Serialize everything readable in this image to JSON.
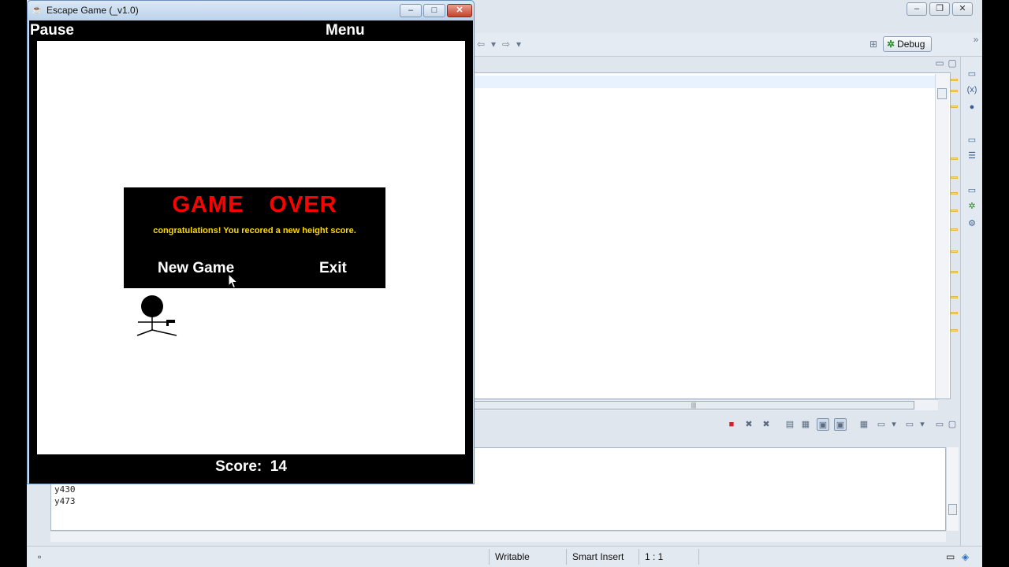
{
  "ide": {
    "perspective_label": "Debug",
    "console_lines": [
      "y430",
      "y473"
    ],
    "status": {
      "writable": "Writable",
      "insert_mode": "Smart Insert",
      "position": "1 : 1"
    }
  },
  "game_window": {
    "title": "Escape Game (_v1.0)",
    "buttons": {
      "minimize": "–",
      "maximize": "□",
      "close": "✕"
    },
    "top_left_label": "Pause",
    "top_right_label": "Menu",
    "score_label": "Score:",
    "score_value": "14",
    "game_over": {
      "word1": "GAME",
      "word2": "OVER",
      "message": "congratulations! You recored a new height score.",
      "new_game": "New Game",
      "exit": "Exit"
    }
  },
  "colors": {
    "game_over_title": "#ff0000",
    "game_over_message": "#ffd700",
    "game_background": "#000000",
    "playfield": "#ffffff"
  }
}
